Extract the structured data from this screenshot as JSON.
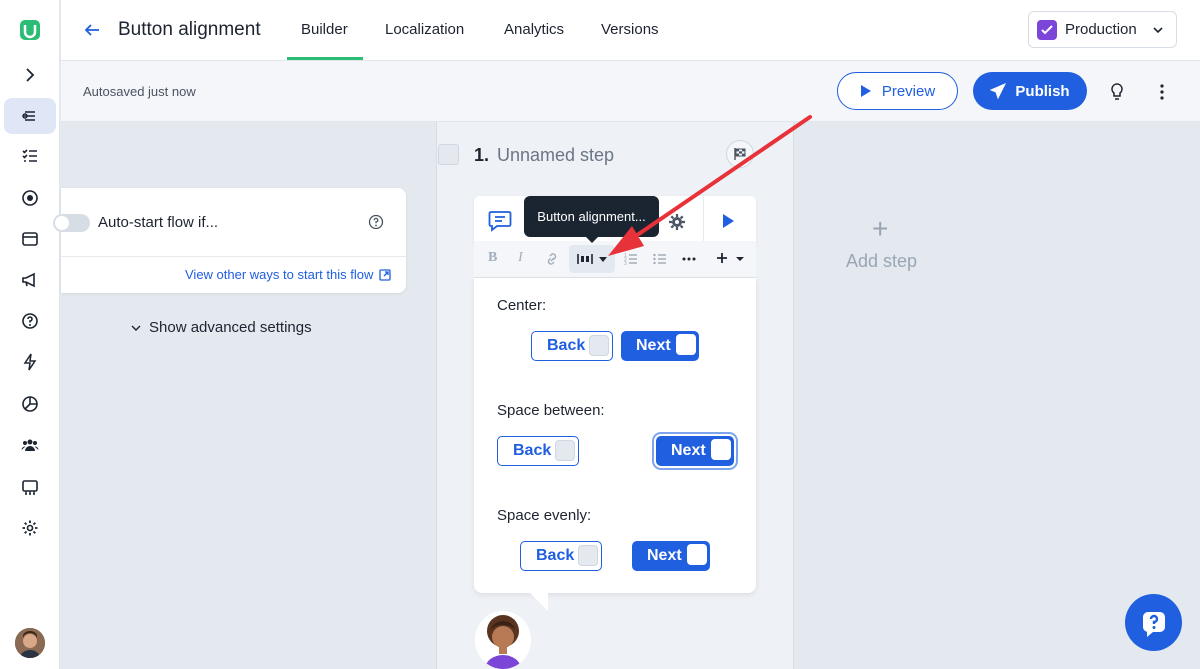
{
  "header": {
    "title": "Button alignment",
    "tabs": [
      {
        "label": "Builder"
      },
      {
        "label": "Localization"
      },
      {
        "label": "Analytics"
      },
      {
        "label": "Versions"
      }
    ],
    "environment": "Production"
  },
  "subheader": {
    "autosave": "Autosaved just now",
    "preview_label": "Preview",
    "publish_label": "Publish"
  },
  "trigger": {
    "autostart_label": "Auto-start flow if...",
    "view_other_label": "View other ways to start this flow",
    "advanced_label": "Show advanced settings"
  },
  "step": {
    "number": "1.",
    "name": "Unnamed step"
  },
  "tooltip": "Button alignment...",
  "sections": [
    {
      "label": "Center:",
      "back": "Back",
      "next": "Next"
    },
    {
      "label": "Space between:",
      "back": "Back",
      "next": "Next"
    },
    {
      "label": "Space evenly:",
      "back": "Back",
      "next": "Next"
    }
  ],
  "add_step": {
    "plus": "+",
    "label": "Add step"
  },
  "colors": {
    "accent": "#1f5fe0",
    "tab_underline": "#2bbd73",
    "arrow": "#e8323a",
    "tooltip_bg": "#1b2531"
  },
  "icons": {
    "rail": [
      "chevron-right-icon",
      "flows-icon",
      "checklist-icon",
      "target-icon",
      "window-icon",
      "megaphone-icon",
      "help-circle-icon",
      "lightning-icon",
      "pie-chart-icon",
      "users-icon",
      "dashboard-icon",
      "gear-icon"
    ]
  }
}
